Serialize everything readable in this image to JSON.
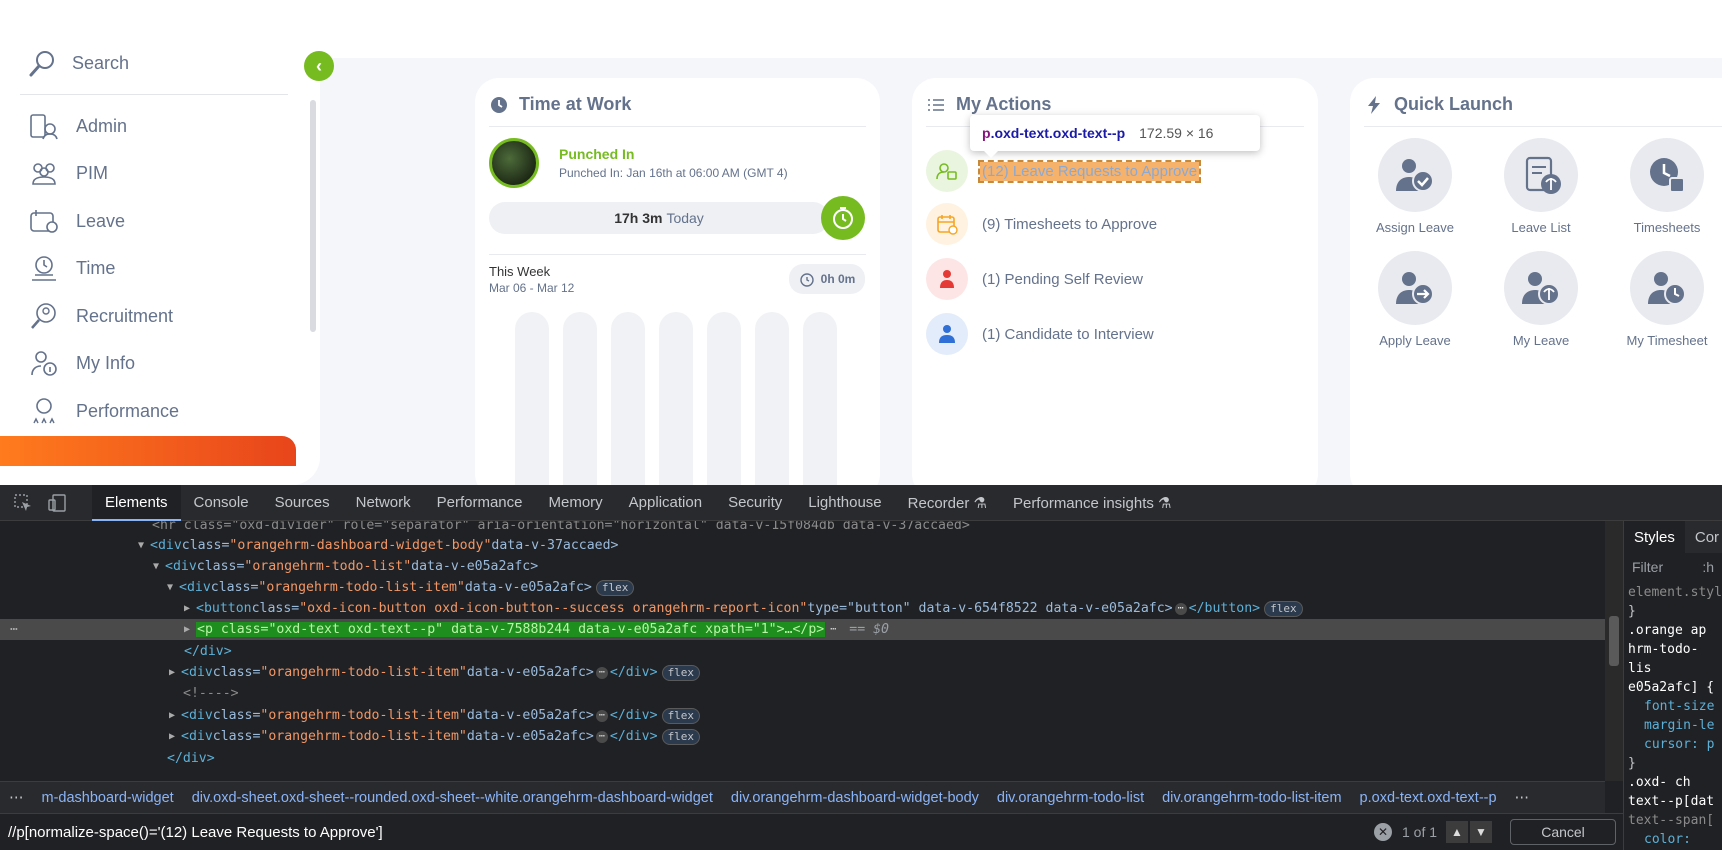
{
  "sidebar": {
    "search_label": "Search",
    "items": [
      {
        "label": "Admin",
        "icon": "admin-icon"
      },
      {
        "label": "PIM",
        "icon": "pim-icon"
      },
      {
        "label": "Leave",
        "icon": "leave-icon"
      },
      {
        "label": "Time",
        "icon": "time-icon"
      },
      {
        "label": "Recruitment",
        "icon": "recruitment-icon"
      },
      {
        "label": "My Info",
        "icon": "my-info-icon"
      },
      {
        "label": "Performance",
        "icon": "performance-icon"
      }
    ],
    "toggle_glyph": "‹"
  },
  "time_at_work": {
    "title": "Time at Work",
    "status": "Punched In",
    "since": "Punched In: Jan 16th at 06:00 AM (GMT 4)",
    "today_hours": "17h 3m",
    "today_label": "Today",
    "week_title": "This Week",
    "week_range": "Mar 06 - Mar 12",
    "week_total": "0h 0m"
  },
  "my_actions": {
    "title": "My Actions",
    "items": [
      {
        "label": "(12) Leave Requests to Approve",
        "icon": "leave-request-icon"
      },
      {
        "label": "(9) Timesheets to Approve",
        "icon": "timesheet-approve-icon"
      },
      {
        "label": "(1) Pending Self Review",
        "icon": "self-review-icon"
      },
      {
        "label": "(1) Candidate to Interview",
        "icon": "candidate-interview-icon"
      }
    ]
  },
  "quick_launch": {
    "title": "Quick Launch",
    "items": [
      {
        "label": "Assign Leave",
        "icon": "assign-leave-icon"
      },
      {
        "label": "Leave List",
        "icon": "leave-list-icon"
      },
      {
        "label": "Timesheets",
        "icon": "timesheets-icon"
      },
      {
        "label": "Apply Leave",
        "icon": "apply-leave-icon"
      },
      {
        "label": "My Leave",
        "icon": "my-leave-icon"
      },
      {
        "label": "My Timesheet",
        "icon": "my-timesheet-icon"
      }
    ]
  },
  "tooltip": {
    "tag": "p",
    "classes": ".oxd-text.oxd-text--p",
    "size": "172.59 × 16"
  },
  "devtools": {
    "tabs": [
      "Elements",
      "Console",
      "Sources",
      "Network",
      "Performance",
      "Memory",
      "Application",
      "Security",
      "Lighthouse",
      "Recorder ⚗",
      "Performance insights ⚗"
    ],
    "active_tab": "Elements",
    "dom_lines": {
      "l0": "<hr class=\"oxd-divider\" role=\"separator\" aria-orientation=\"horizontal\" data-v-15f084db data-v-37accaed>",
      "l1_tag": "<div ",
      "l1_attr": "class=",
      "l1_val": "\"orangehrm-dashboard-widget-body\"",
      "l1_rest": " data-v-37accaed>",
      "l2_tag": "<div ",
      "l2_attr": "class=",
      "l2_val": "\"orangehrm-todo-list\"",
      "l2_rest": " data-v-e05a2afc>",
      "l3_tag": "<div ",
      "l3_attr": "class=",
      "l3_val": "\"orangehrm-todo-list-item\"",
      "l3_rest": " data-v-e05a2afc>",
      "l4_tag": "<button ",
      "l4_attr": "class=",
      "l4_val": "\"oxd-icon-button oxd-icon-button--success orangehrm-report-icon\"",
      "l4_rest": " type=\"button\" data-v-654f8522 data-v-e05a2afc>",
      "l4_end": "</button>",
      "l5_sel": "<p class=\"oxd-text oxd-text--p\" data-v-7588b244 data-v-e05a2afc xpath=\"1\">…</p>",
      "l5_eq": "== $0",
      "l6": "</div>",
      "l7_tag": "<div ",
      "l7_attr": "class=",
      "l7_val": "\"orangehrm-todo-list-item\"",
      "l7_rest": " data-v-e05a2afc>",
      "l7_end": "</div>",
      "l8": "<!---->",
      "l9_tag": "<div ",
      "l9_attr": "class=",
      "l9_val": "\"orangehrm-todo-list-item\"",
      "l9_rest": " data-v-e05a2afc>",
      "l9_end": "</div>",
      "l10_tag": "<div ",
      "l10_attr": "class=",
      "l10_val": "\"orangehrm-todo-list-item\"",
      "l10_rest": " data-v-e05a2afc>",
      "l10_end": "</div>",
      "l11": "</div>",
      "badge": "flex",
      "ellipsis": "⋯"
    },
    "breadcrumbs": [
      "m-dashboard-widget",
      "div.oxd-sheet.oxd-sheet--rounded.oxd-sheet--white.orangehrm-dashboard-widget",
      "div.orangehrm-dashboard-widget-body",
      "div.orangehrm-todo-list",
      "div.orangehrm-todo-list-item",
      "p.oxd-text.oxd-text--p"
    ],
    "search_value": "//p[normalize-space()='(12) Leave Requests to Approve']",
    "match_count": "1 of 1",
    "cancel_label": "Cancel",
    "styles_tabs": [
      "Styles",
      "Cor"
    ],
    "styles_filter": "Filter",
    "styles_hov": ":h",
    "styles_lines": [
      "element.styl",
      "}",
      ".orange ap",
      "hrm-todo-lis",
      "e05a2afc] {",
      "font-size",
      "margin-le",
      "cursor: p",
      "}",
      ".oxd- ch",
      "text--p[dat",
      "text--span[",
      "color: "
    ]
  }
}
